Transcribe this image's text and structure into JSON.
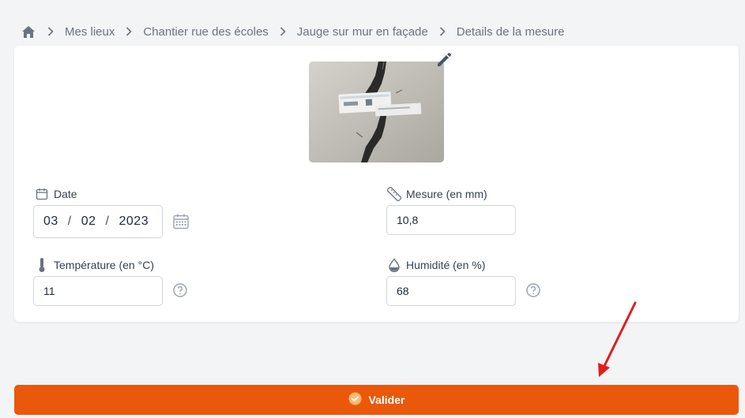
{
  "breadcrumb": {
    "items": [
      {
        "label": "Mes lieux"
      },
      {
        "label": "Chantier rue des écoles"
      },
      {
        "label": "Jauge sur mur en façade"
      },
      {
        "label": "Details de la mesure"
      }
    ]
  },
  "form": {
    "date": {
      "label": "Date",
      "day": "03",
      "month": "02",
      "year": "2023",
      "icon": "calendar-icon"
    },
    "measure": {
      "label": "Mesure (en mm)",
      "value": "10,8",
      "icon": "ruler-icon"
    },
    "temperature": {
      "label": "Température (en °C)",
      "value": "11",
      "icon": "thermometer-icon"
    },
    "humidity": {
      "label": "Humidité (en %)",
      "value": "68",
      "icon": "droplet-icon"
    }
  },
  "submit": {
    "label": "Valider",
    "color": "#ea580c"
  },
  "colors": {
    "accent": "#ea580c",
    "annotation_arrow": "#e11d1d"
  }
}
